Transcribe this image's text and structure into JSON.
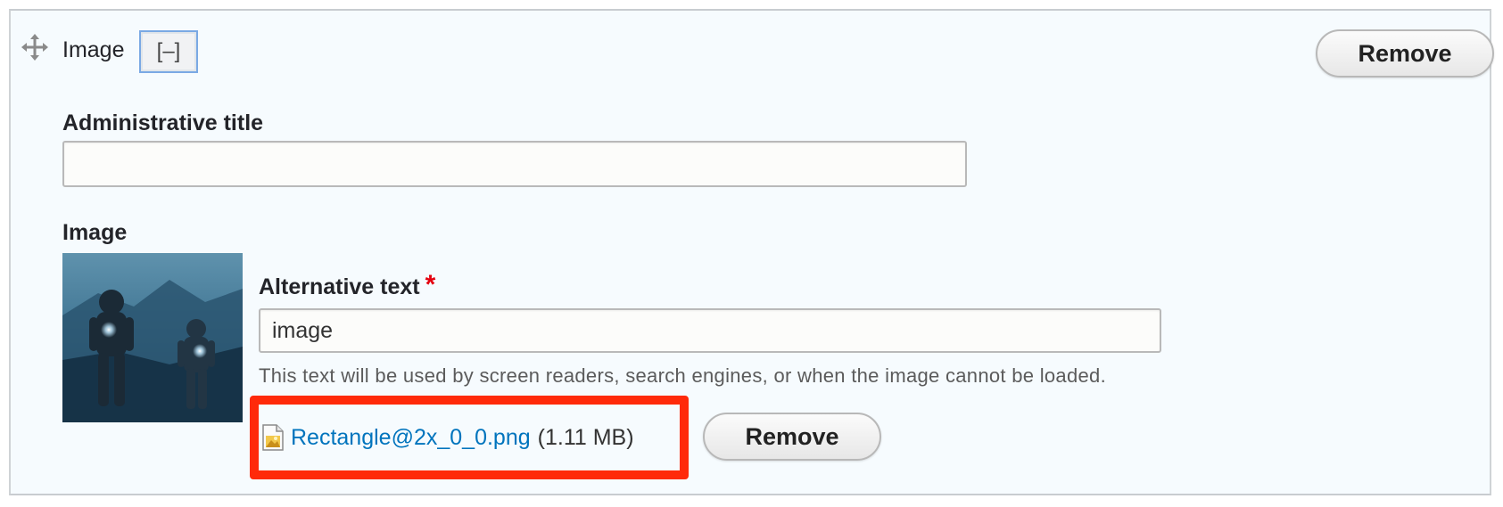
{
  "paragraph": {
    "title": "Image",
    "collapse_label": "[–]",
    "remove_label": "Remove"
  },
  "admin_title": {
    "label": "Administrative title",
    "value": ""
  },
  "image_field": {
    "label": "Image",
    "alt_text": {
      "label": "Alternative text",
      "required_marker": "*",
      "value": "image",
      "help": "This text will be used by screen readers, search engines, or when the image cannot be loaded."
    },
    "file": {
      "name": "Rectangle@2x_0_0.png",
      "size": "(1.11 MB)",
      "icon": "image-file-icon"
    },
    "remove_label": "Remove"
  },
  "colors": {
    "panel_background": "#f6fbfe",
    "link": "#0074bd",
    "required": "#e4000f",
    "highlight": "#ff2a0a"
  }
}
